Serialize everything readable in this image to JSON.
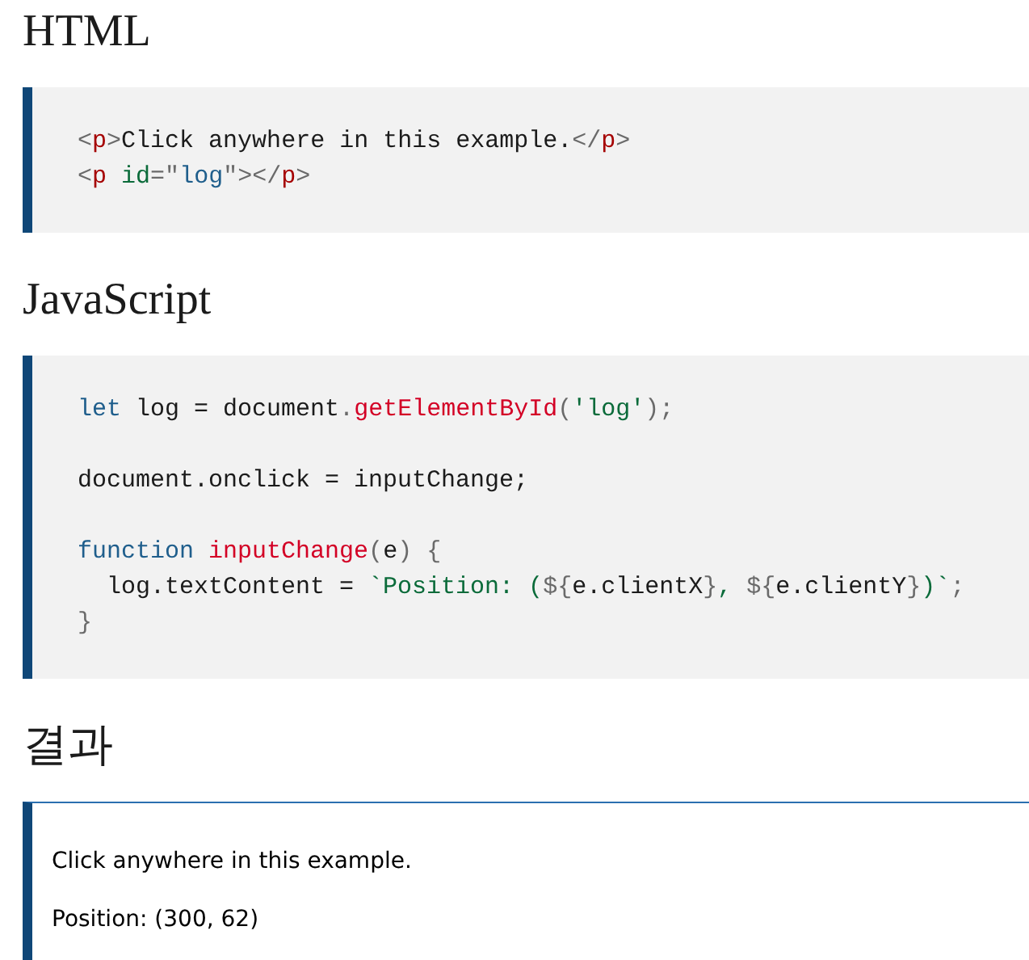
{
  "sections": [
    {
      "heading": "HTML",
      "block": {
        "kind": "code",
        "lines": [
          {
            "kind": "code",
            "tokens": [
              {
                "kind": "punct",
                "text": "<"
              },
              {
                "kind": "tag",
                "text": "p"
              },
              {
                "kind": "punct",
                "text": ">"
              },
              {
                "kind": "plain",
                "text": "Click anywhere in this example."
              },
              {
                "kind": "punct",
                "text": "</"
              },
              {
                "kind": "tag",
                "text": "p"
              },
              {
                "kind": "punct",
                "text": ">"
              }
            ]
          },
          {
            "kind": "code",
            "tokens": [
              {
                "kind": "punct",
                "text": "<"
              },
              {
                "kind": "tag",
                "text": "p"
              },
              {
                "kind": "attr",
                "text": " id"
              },
              {
                "kind": "punct",
                "text": "=\""
              },
              {
                "kind": "value",
                "text": "log"
              },
              {
                "kind": "punct",
                "text": "\"></"
              },
              {
                "kind": "tag",
                "text": "p"
              },
              {
                "kind": "punct",
                "text": ">"
              }
            ]
          }
        ]
      }
    },
    {
      "heading": "JavaScript",
      "block": {
        "kind": "code",
        "lines": [
          {
            "kind": "code",
            "tokens": [
              {
                "kind": "keyword",
                "text": "let"
              },
              {
                "kind": "plain",
                "text": " log = document"
              },
              {
                "kind": "punct",
                "text": "."
              },
              {
                "kind": "function",
                "text": "getElementById"
              },
              {
                "kind": "punct",
                "text": "("
              },
              {
                "kind": "string",
                "text": "'log'"
              },
              {
                "kind": "punct",
                "text": ");"
              }
            ]
          },
          {
            "kind": "blank"
          },
          {
            "kind": "code",
            "tokens": [
              {
                "kind": "plain",
                "text": "document.onclick = inputChange;"
              }
            ]
          },
          {
            "kind": "blank"
          },
          {
            "kind": "code",
            "tokens": [
              {
                "kind": "keyword",
                "text": "function "
              },
              {
                "kind": "function",
                "text": "inputChange"
              },
              {
                "kind": "punct",
                "text": "("
              },
              {
                "kind": "plain",
                "text": "e"
              },
              {
                "kind": "punct",
                "text": ") {"
              }
            ]
          },
          {
            "kind": "code",
            "tokens": [
              {
                "kind": "plain",
                "text": "  log.textContent = "
              },
              {
                "kind": "string",
                "text": "`Position: ("
              },
              {
                "kind": "punct",
                "text": "${"
              },
              {
                "kind": "plain",
                "text": "e.clientX"
              },
              {
                "kind": "punct",
                "text": "}"
              },
              {
                "kind": "string",
                "text": ", "
              },
              {
                "kind": "punct",
                "text": "${"
              },
              {
                "kind": "plain",
                "text": "e.clientY"
              },
              {
                "kind": "punct",
                "text": "}"
              },
              {
                "kind": "string",
                "text": ")`"
              },
              {
                "kind": "punct",
                "text": ";"
              }
            ]
          },
          {
            "kind": "code",
            "tokens": [
              {
                "kind": "punct",
                "text": "}"
              }
            ]
          }
        ]
      }
    },
    {
      "heading": "결과",
      "block": {
        "kind": "result",
        "paragraphs": [
          "Click anywhere in this example.",
          "Position: (300, 62)"
        ]
      }
    }
  ]
}
